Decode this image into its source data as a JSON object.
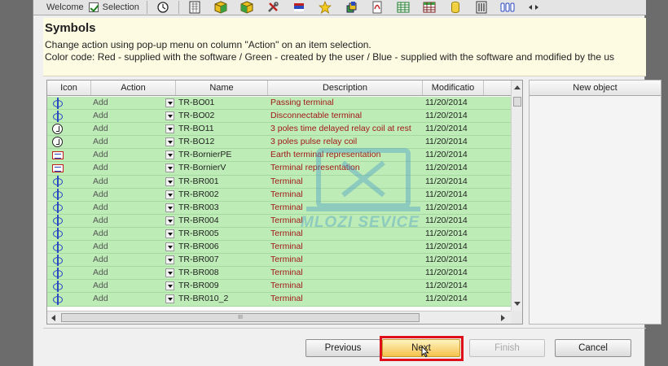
{
  "tabs": {
    "welcome": "Welcome",
    "selection": "Selection",
    "selection_checked": true
  },
  "toolbar_icons": [
    "timer-icon",
    "grid-page-icon",
    "cube-icon",
    "cube-alt-icon",
    "tools-icon",
    "flag-icon",
    "star-icon",
    "stack-icon",
    "pdf-icon",
    "table-icon",
    "table-alt-icon",
    "cylinder-icon",
    "cabinet-icon",
    "terminal-strip-icon",
    "arrows-icon"
  ],
  "header": {
    "title": "Symbols",
    "line1": "Change action using pop-up menu on column \"Action\" on an item selection.",
    "line2": "Color code: Red - supplied with the software / Green - created by the user / Blue - supplied with the software and modified by the us"
  },
  "grid": {
    "columns": {
      "icon": "Icon",
      "action": "Action",
      "name": "Name",
      "description": "Description",
      "modification": "Modificatio"
    },
    "rows": [
      {
        "icon": "terminal-icon",
        "action": "Add",
        "name": "TR-BO01",
        "description": "Passing terminal",
        "modified": "11/20/2014"
      },
      {
        "icon": "terminal-icon",
        "action": "Add",
        "name": "TR-BO02",
        "description": "Disconnectable terminal",
        "modified": "11/20/2014"
      },
      {
        "icon": "coil-icon",
        "action": "Add",
        "name": "TR-BO11",
        "description": "3 poles time delayed relay coil at rest",
        "modified": "11/20/2014"
      },
      {
        "icon": "coil-icon",
        "action": "Add",
        "name": "TR-BO12",
        "description": "3 poles pulse relay coil",
        "modified": "11/20/2014"
      },
      {
        "icon": "earth-icon",
        "action": "Add",
        "name": "TR-BornierPE",
        "description": "Earth terminal representation",
        "modified": "11/20/2014"
      },
      {
        "icon": "earth-icon",
        "action": "Add",
        "name": "TR-BornierV",
        "description": "Terminal representation",
        "modified": "11/20/2014"
      },
      {
        "icon": "terminal-icon",
        "action": "Add",
        "name": "TR-BR001",
        "description": "Terminal",
        "modified": "11/20/2014"
      },
      {
        "icon": "terminal-icon",
        "action": "Add",
        "name": "TR-BR002",
        "description": "Terminal",
        "modified": "11/20/2014"
      },
      {
        "icon": "terminal-icon",
        "action": "Add",
        "name": "TR-BR003",
        "description": "Terminal",
        "modified": "11/20/2014"
      },
      {
        "icon": "terminal-icon",
        "action": "Add",
        "name": "TR-BR004",
        "description": "Terminal",
        "modified": "11/20/2014"
      },
      {
        "icon": "terminal-icon",
        "action": "Add",
        "name": "TR-BR005",
        "description": "Terminal",
        "modified": "11/20/2014"
      },
      {
        "icon": "terminal-icon",
        "action": "Add",
        "name": "TR-BR006",
        "description": "Terminal",
        "modified": "11/20/2014"
      },
      {
        "icon": "terminal-icon",
        "action": "Add",
        "name": "TR-BR007",
        "description": "Terminal",
        "modified": "11/20/2014"
      },
      {
        "icon": "terminal-icon",
        "action": "Add",
        "name": "TR-BR008",
        "description": "Terminal",
        "modified": "11/20/2014"
      },
      {
        "icon": "terminal-icon",
        "action": "Add",
        "name": "TR-BR009",
        "description": "Terminal",
        "modified": "11/20/2014"
      },
      {
        "icon": "terminal-icon",
        "action": "Add",
        "name": "TR-BR010_2",
        "description": "Terminal",
        "modified": "11/20/2014"
      }
    ],
    "scroll_grip": "III"
  },
  "right_panel": {
    "header": "New object"
  },
  "buttons": {
    "previous": "Previous",
    "next": "Next",
    "finish": "Finish",
    "cancel": "Cancel"
  },
  "watermark": {
    "text": "MLOZI SEVICE"
  },
  "colors": {
    "row_green": "#bdecb6",
    "description_red": "#a21818",
    "header_yellow": "#fdfbe2",
    "highlight_red": "#e0101a",
    "next_button": "#f4c24c"
  }
}
